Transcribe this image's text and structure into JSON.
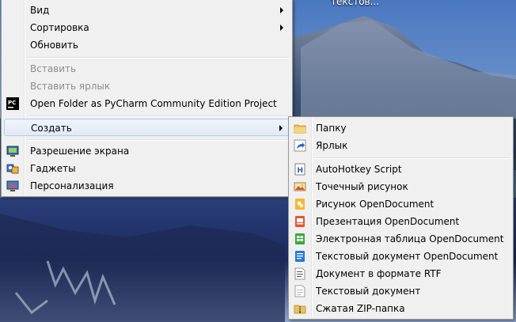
{
  "desktop": {
    "label": "текстов..."
  },
  "main_menu": {
    "items": [
      {
        "label": "Вид",
        "arrow": true,
        "icon": null,
        "disabled": false
      },
      {
        "label": "Сортировка",
        "arrow": true,
        "icon": null,
        "disabled": false
      },
      {
        "label": "Обновить",
        "arrow": false,
        "icon": null,
        "disabled": false
      },
      {
        "label": "Вставить",
        "arrow": false,
        "icon": null,
        "disabled": true
      },
      {
        "label": "Вставить ярлык",
        "arrow": false,
        "icon": null,
        "disabled": true
      },
      {
        "label": "Open Folder as PyCharm Community Edition Project",
        "arrow": false,
        "icon": "pycharm-icon",
        "disabled": false
      },
      {
        "label": "Создать",
        "arrow": true,
        "icon": null,
        "disabled": false,
        "highlighted": true
      },
      {
        "label": "Разрешение экрана",
        "arrow": false,
        "icon": "screen-resolution-icon",
        "disabled": false
      },
      {
        "label": "Гаджеты",
        "arrow": false,
        "icon": "gadgets-icon",
        "disabled": false
      },
      {
        "label": "Персонализация",
        "arrow": false,
        "icon": "personalization-icon",
        "disabled": false
      }
    ],
    "pycharm_icon_text": "PC"
  },
  "sub_menu": {
    "items": [
      {
        "label": "Папку",
        "icon": "folder-icon"
      },
      {
        "label": "Ярлык",
        "icon": "shortcut-icon"
      },
      {
        "label": "AutoHotkey Script",
        "icon": "autohotkey-icon"
      },
      {
        "label": "Точечный рисунок",
        "icon": "bitmap-icon"
      },
      {
        "label": "Рисунок OpenDocument",
        "icon": "odg-icon"
      },
      {
        "label": "Презентация OpenDocument",
        "icon": "odp-icon"
      },
      {
        "label": "Электронная таблица OpenDocument",
        "icon": "ods-icon"
      },
      {
        "label": "Текстовый документ OpenDocument",
        "icon": "odt-icon"
      },
      {
        "label": "Документ в формате RTF",
        "icon": "rtf-icon"
      },
      {
        "label": "Текстовый документ",
        "icon": "txt-icon"
      },
      {
        "label": "Сжатая ZIP-папка",
        "icon": "zip-folder-icon"
      }
    ],
    "ahk_icon_text": "H"
  },
  "colors": {
    "menu_bg": "#f0f0f0",
    "highlight_border": "#aeccf1",
    "disabled_text": "#8d8d8d"
  }
}
